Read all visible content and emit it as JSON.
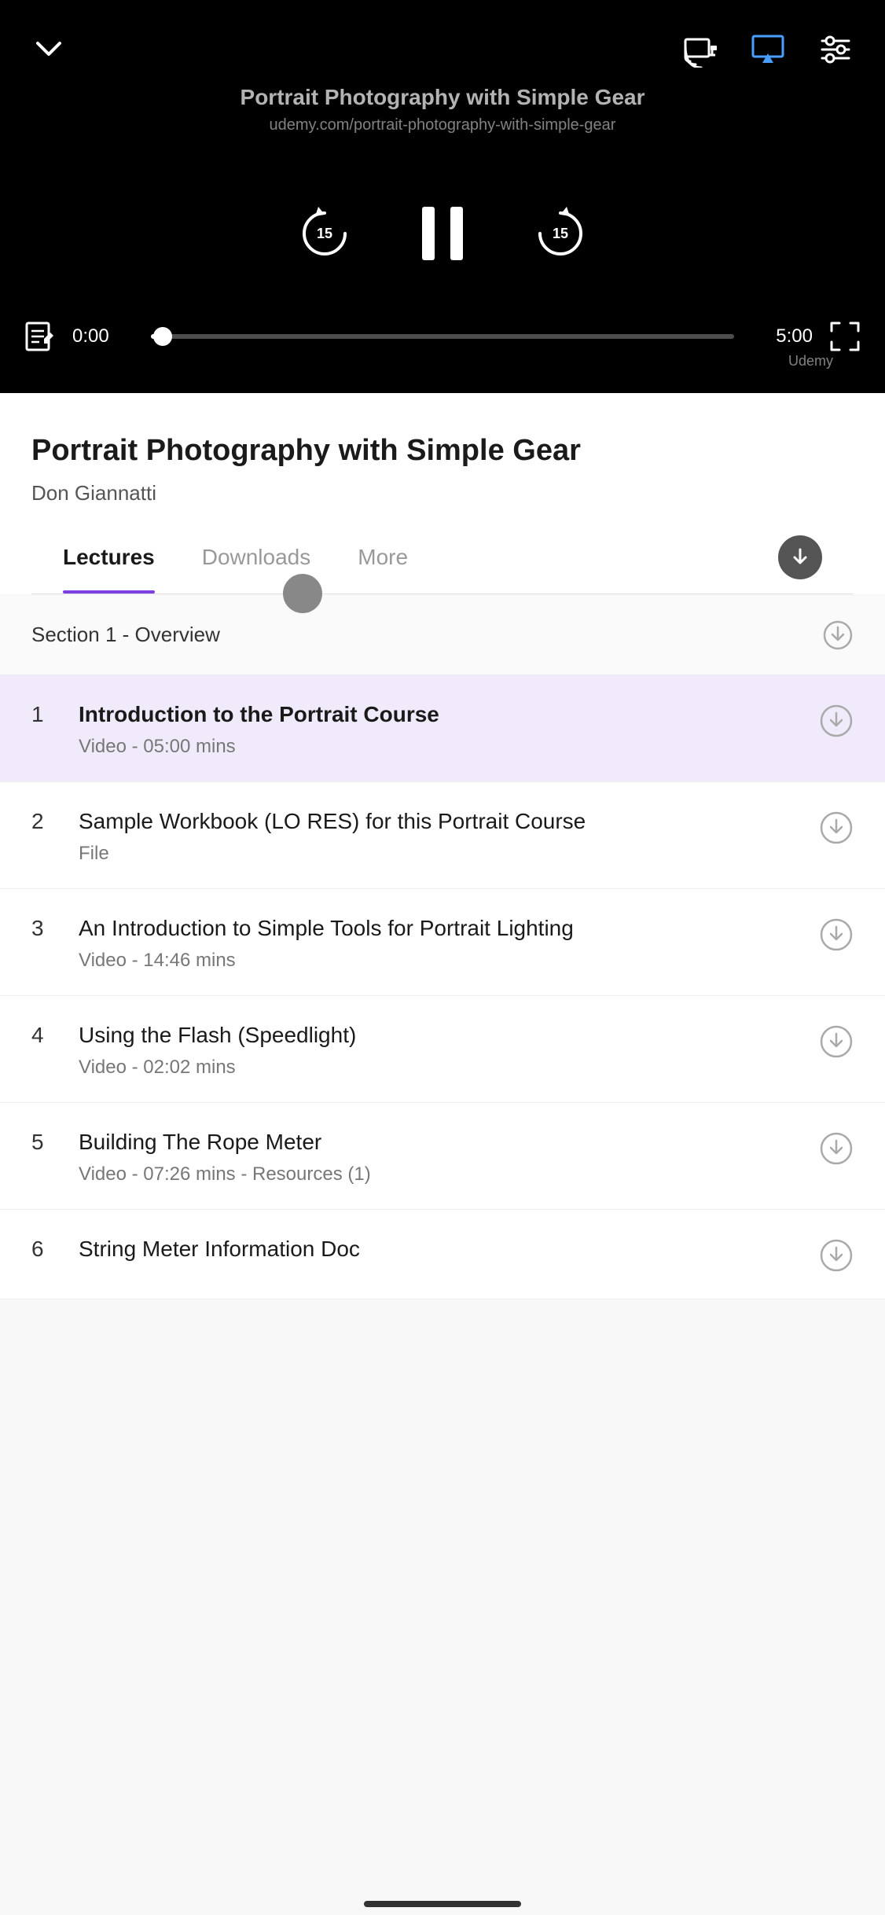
{
  "player": {
    "course_title": "Portrait Photography with Simple Gear",
    "course_url": "udemy.com/portrait-photography-with-simple-gear",
    "current_time": "0:00",
    "end_time": "5:00",
    "progress_percent": 2,
    "watermark": "Udemy",
    "rewind_seconds": "15",
    "forward_seconds": "15"
  },
  "course": {
    "title": "Portrait Photography with Simple Gear",
    "instructor": "Don Giannatti"
  },
  "tabs": [
    {
      "label": "Lectures",
      "active": true
    },
    {
      "label": "Downloads",
      "active": false
    },
    {
      "label": "More",
      "active": false
    }
  ],
  "section1": {
    "title": "Section 1 - Overview"
  },
  "lectures": [
    {
      "number": "1",
      "title": "Introduction to the Portrait Course",
      "meta": "Video - 05:00 mins",
      "active": true
    },
    {
      "number": "2",
      "title": "Sample Workbook (LO RES) for this Portrait Course",
      "meta": "File",
      "active": false
    },
    {
      "number": "3",
      "title": "An Introduction to Simple Tools for Portrait Lighting",
      "meta": "Video - 14:46 mins",
      "active": false
    },
    {
      "number": "4",
      "title": "Using the Flash (Speedlight)",
      "meta": "Video - 02:02 mins",
      "active": false
    },
    {
      "number": "5",
      "title": "Building The Rope Meter",
      "meta": "Video - 07:26 mins - Resources (1)",
      "active": false
    },
    {
      "number": "6",
      "title": "String Meter Information Doc",
      "meta": "",
      "active": false
    }
  ]
}
